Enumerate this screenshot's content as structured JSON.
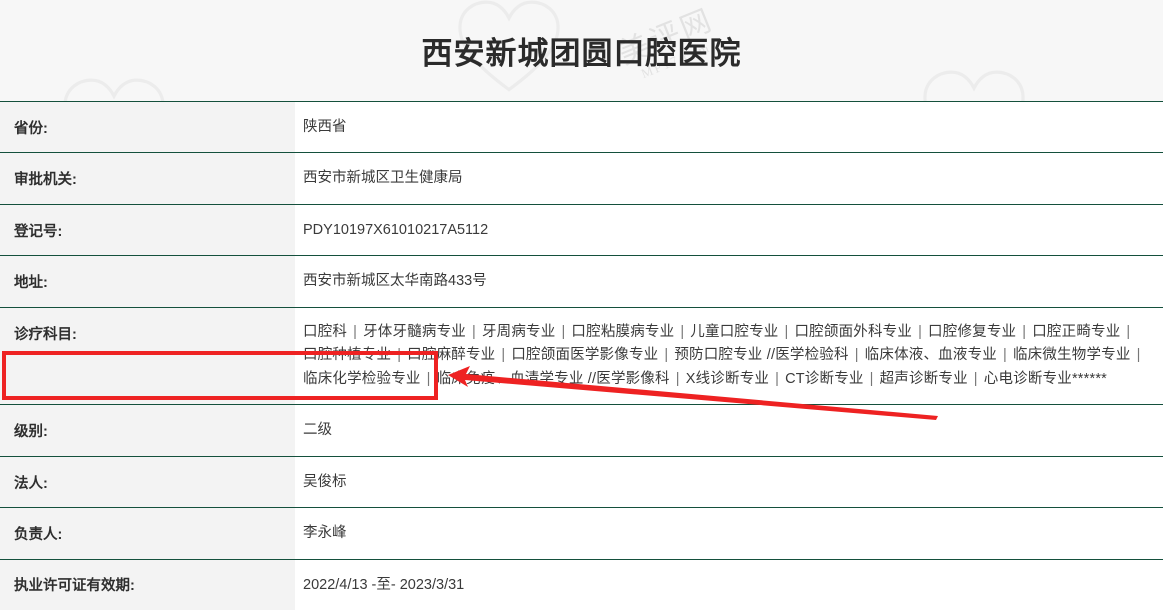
{
  "header": {
    "title": "西安新城团圆口腔医院"
  },
  "watermark": {
    "main": "美评网",
    "sub": "MP17.com",
    "icon": "heart-outline-icon"
  },
  "table": {
    "rows": [
      {
        "label": "省份:",
        "value": "陕西省"
      },
      {
        "label": "审批机关:",
        "value": "西安市新城区卫生健康局"
      },
      {
        "label": "登记号:",
        "value": "PDY10197X61010217A5112"
      },
      {
        "label": "地址:",
        "value": "西安市新城区太华南路433号"
      },
      {
        "label": "诊疗科目:",
        "value": ""
      },
      {
        "label": "级别:",
        "value": "二级"
      },
      {
        "label": "法人:",
        "value": "吴俊标"
      },
      {
        "label": "负责人:",
        "value": "李永峰"
      },
      {
        "label": "执业许可证有效期:",
        "value": "2022/4/13 -至- 2023/3/31"
      }
    ],
    "subjects": [
      "口腔科",
      "牙体牙髓病专业",
      "牙周病专业",
      "口腔粘膜病专业",
      "儿童口腔专业",
      "口腔颌面外科专业",
      "口腔修复专业",
      "口腔正畸专业",
      "口腔种植专业",
      "口腔麻醉专业",
      "口腔颌面医学影像专业",
      "预防口腔专业 //医学检验科",
      "临床体液、血液专业",
      "临床微生物学专业",
      "临床化学检验专业",
      "临床免疫、血清学专业 //医学影像科",
      "X线诊断专业",
      "CT诊断专业",
      "超声诊断专业",
      "心电诊断专业******"
    ],
    "subject_separator": "|"
  },
  "annotation": {
    "highlight_color": "#ee2222",
    "arrow_color": "#ee2222",
    "highlighted_row_label": "级别:",
    "highlighted_row_value": "二级"
  }
}
